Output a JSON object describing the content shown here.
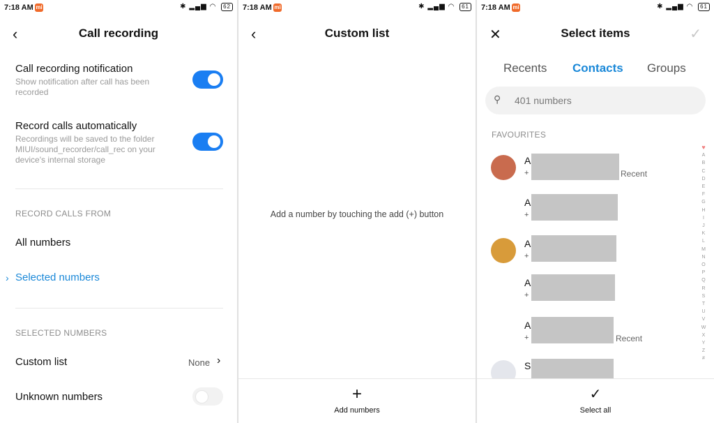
{
  "status_bar": [
    {
      "time": "7:18 AM",
      "battery": "62"
    },
    {
      "time": "7:18 AM",
      "battery": "61"
    },
    {
      "time": "7:18 AM",
      "battery": "61"
    }
  ],
  "screen1": {
    "title": "Call recording",
    "notification": {
      "title": "Call recording notification",
      "subtitle": "Show notification after call has been recorded",
      "enabled": true
    },
    "auto_record": {
      "title": "Record calls automatically",
      "subtitle": "Recordings will be saved to the folder MIUI/sound_recorder/call_rec on your device's internal storage",
      "enabled": true
    },
    "record_from_header": "RECORD CALLS FROM",
    "options": [
      "All numbers",
      "Selected numbers"
    ],
    "selected_option": "Selected numbers",
    "selected_header": "SELECTED NUMBERS",
    "custom_list": {
      "label": "Custom list",
      "value": "None"
    },
    "unknown_numbers": {
      "label": "Unknown numbers",
      "enabled": false
    }
  },
  "screen2": {
    "title": "Custom list",
    "empty_message": "Add a number by touching the add (+) button",
    "add_button": "Add numbers"
  },
  "screen3": {
    "title": "Select items",
    "tabs": [
      "Recents",
      "Contacts",
      "Groups"
    ],
    "active_tab": "Contacts",
    "search_placeholder": "401 numbers",
    "section": "FAVOURITES",
    "contacts": [
      {
        "initial": "A",
        "number": "+",
        "tag": "Recent",
        "avatar": "photo"
      },
      {
        "initial": "A",
        "number": "+",
        "tag": "",
        "avatar": "none"
      },
      {
        "initial": "A",
        "number": "+",
        "tag": "",
        "avatar": "photo"
      },
      {
        "initial": "A",
        "number": "+",
        "tag": "",
        "avatar": "none"
      },
      {
        "initial": "A",
        "number": "+",
        "tag": "Recent",
        "avatar": "none"
      },
      {
        "initial": "S",
        "number": "",
        "tag": "",
        "avatar": "placeholder"
      }
    ],
    "alphabet": [
      "A",
      "B",
      "C",
      "D",
      "E",
      "F",
      "G",
      "H",
      "I",
      "J",
      "K",
      "L",
      "M",
      "N",
      "O",
      "P",
      "Q",
      "R",
      "S",
      "T",
      "U",
      "V",
      "W",
      "X",
      "Y",
      "Z",
      "#"
    ],
    "select_all": "Select all"
  },
  "colors": {
    "accent": "#1a88d8",
    "toggle_on": "#1a7ef2",
    "mi_badge": "#f06a2a",
    "redaction": "#c5c5c5"
  }
}
